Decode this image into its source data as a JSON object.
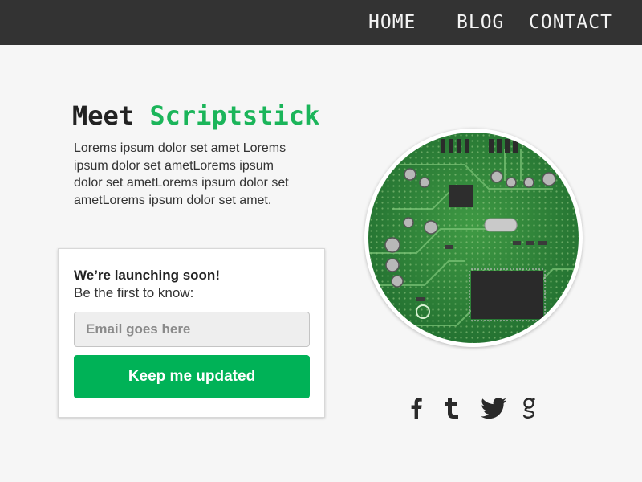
{
  "nav": {
    "items": [
      {
        "label": "Home"
      },
      {
        "label": "Blog"
      },
      {
        "label": "Contact"
      }
    ]
  },
  "hero": {
    "title_prefix": "Meet",
    "title_brand": "Scriptstick",
    "intro": "Lorems ipsum dolor set amet Lorems ipsum dolor set ametLorems ipsum dolor set ametLorems ipsum dolor set ametLorems ipsum dolor set amet."
  },
  "signup": {
    "heading": "We’re launching soon!",
    "subheading": "Be the first to know:",
    "email_placeholder": "Email goes here",
    "email_value": "",
    "button_label": "Keep me updated"
  },
  "social": {
    "icons": [
      "facebook-icon",
      "tumblr-icon",
      "twitter-icon",
      "google-plus-icon"
    ],
    "glyphs": {
      "facebook": "f",
      "tumblr": "t",
      "google": "g"
    }
  },
  "colors": {
    "topbar": "#333333",
    "accent": "#1bb55a",
    "button": "#00b257",
    "page_bg": "#f6f6f6"
  }
}
